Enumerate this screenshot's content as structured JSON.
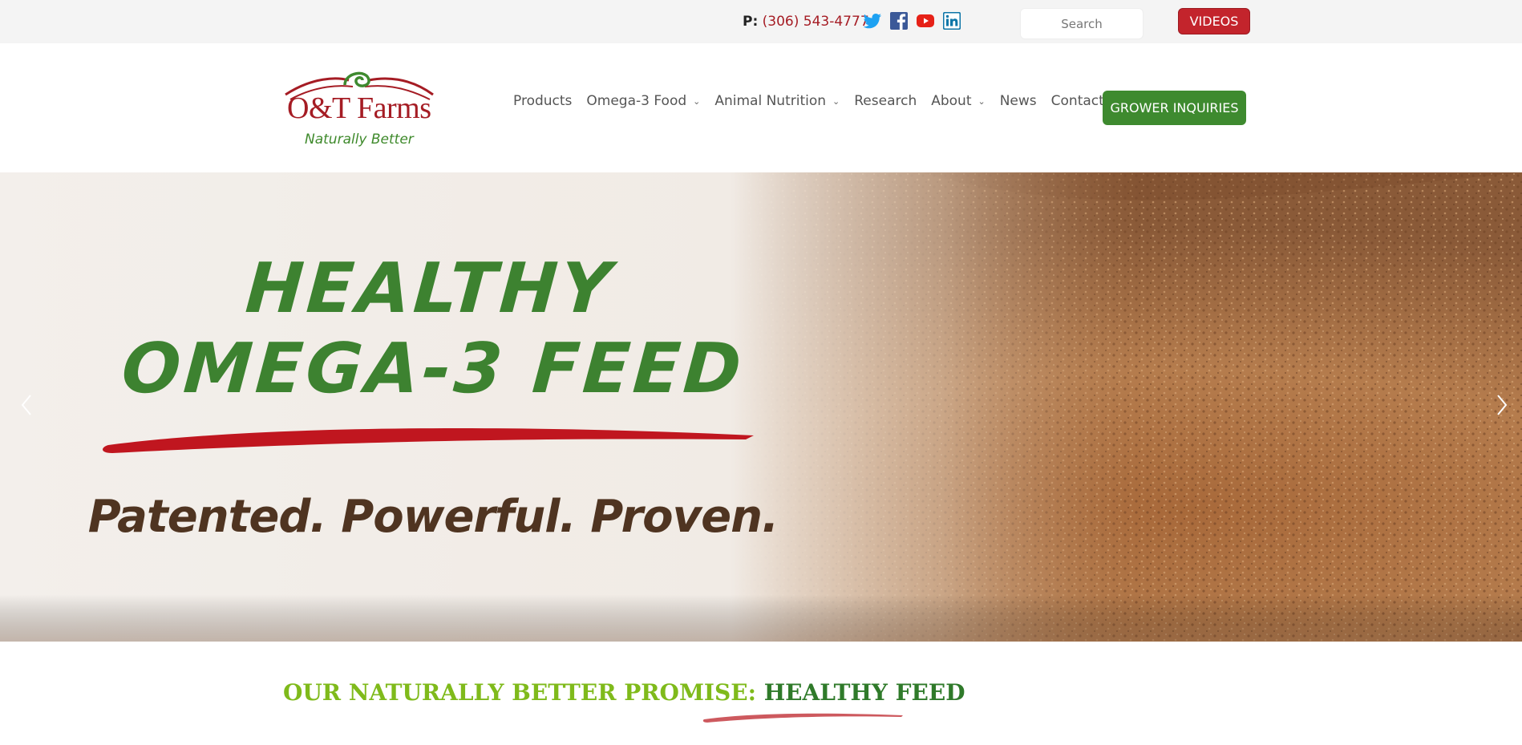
{
  "topbar": {
    "phone_label": "P:",
    "phone_number": "(306) 543-4777",
    "social": [
      "twitter-icon",
      "facebook-icon",
      "youtube-icon",
      "linkedin-icon"
    ],
    "search_placeholder": "Search",
    "videos_label": "VIDEOS"
  },
  "header": {
    "logo_name": "O&T Farms",
    "logo_tagline": "Naturally Better",
    "nav": [
      {
        "label": "Products",
        "dropdown": false
      },
      {
        "label": "Omega-3 Food",
        "dropdown": true
      },
      {
        "label": "Animal Nutrition",
        "dropdown": true
      },
      {
        "label": "Research",
        "dropdown": false
      },
      {
        "label": "About",
        "dropdown": true
      },
      {
        "label": "News",
        "dropdown": false
      },
      {
        "label": "Contact",
        "dropdown": false
      }
    ],
    "cta_label": "GROWER INQUIRIES"
  },
  "hero": {
    "title_line1": "HEALTHY",
    "title_line2": "OMEGA-3 FEED",
    "subtitle": "Patented. Powerful. Proven."
  },
  "section": {
    "heading_part1": "OUR NATURALLY BETTER PROMISE: ",
    "heading_part2": "HEALTHY FEED"
  },
  "colors": {
    "brand_red": "#a51c24",
    "brand_green": "#3e8a2f",
    "light_green": "#7fba1b",
    "brown": "#4f3421"
  }
}
